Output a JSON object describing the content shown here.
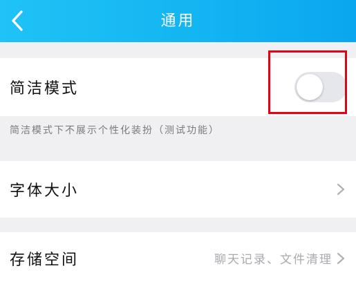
{
  "header": {
    "title": "通用",
    "background_color": "#13b5f2",
    "back_icon": "chevron-left-icon"
  },
  "settings": {
    "simple_mode": {
      "label": "简洁模式",
      "enabled": false,
      "description": "简洁模式下不展示个性化装扮（测试功能）"
    },
    "font_size": {
      "label": "字体大小",
      "icon": "chevron-right-icon"
    },
    "storage": {
      "label": "存储空间",
      "value": "聊天记录、文件清理",
      "icon": "chevron-right-icon"
    }
  },
  "highlight_color": "#e50012"
}
